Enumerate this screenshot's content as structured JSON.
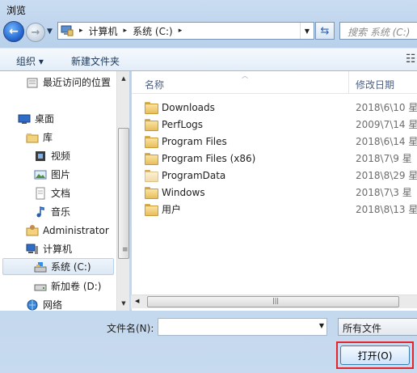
{
  "window": {
    "title": "浏览"
  },
  "nav": {
    "back_glyph": "←",
    "forward_glyph": "→",
    "breadcrumb": [
      "计算机",
      "系统 (C:)"
    ],
    "search_placeholder": "搜索 系统 (C:)"
  },
  "toolbar": {
    "organize_label": "组织 ▾",
    "new_folder_label": "新建文件夹",
    "view_glyph": "☷"
  },
  "sidebar": {
    "items": [
      {
        "label": "最近访问的位置",
        "icon": "recent-places-icon"
      },
      {
        "label": "桌面",
        "icon": "desktop-icon"
      },
      {
        "label": "库",
        "icon": "library-icon"
      },
      {
        "label": "视频",
        "icon": "video-icon"
      },
      {
        "label": "图片",
        "icon": "picture-icon"
      },
      {
        "label": "文档",
        "icon": "document-icon"
      },
      {
        "label": "音乐",
        "icon": "music-icon"
      },
      {
        "label": "Administrator",
        "icon": "user-folder-icon"
      },
      {
        "label": "计算机",
        "icon": "computer-icon"
      },
      {
        "label": "系统 (C:)",
        "icon": "system-drive-icon",
        "selected": true
      },
      {
        "label": "新加卷 (D:)",
        "icon": "drive-icon"
      },
      {
        "label": "网络",
        "icon": "network-icon"
      }
    ]
  },
  "filelist": {
    "columns": {
      "name": "名称",
      "date": "修改日期"
    },
    "rows": [
      {
        "name": "Downloads",
        "date": "2018\\6\\10 星"
      },
      {
        "name": "PerfLogs",
        "date": "2009\\7\\14 星"
      },
      {
        "name": "Program Files",
        "date": "2018\\6\\14 星"
      },
      {
        "name": "Program Files (x86)",
        "date": "2018\\7\\9 星"
      },
      {
        "name": "ProgramData",
        "date": "2018\\8\\29 星",
        "hidden": true
      },
      {
        "name": "Windows",
        "date": "2018\\7\\3 星"
      },
      {
        "name": "用户",
        "date": "2018\\8\\13 星"
      }
    ]
  },
  "bottom": {
    "filename_label": "文件名(N):",
    "filename_value": "",
    "filetype_value": "所有文件",
    "open_button": "打开(O)"
  },
  "colors": {
    "highlight": "#e3262b",
    "accent": "#3c7fb1"
  }
}
